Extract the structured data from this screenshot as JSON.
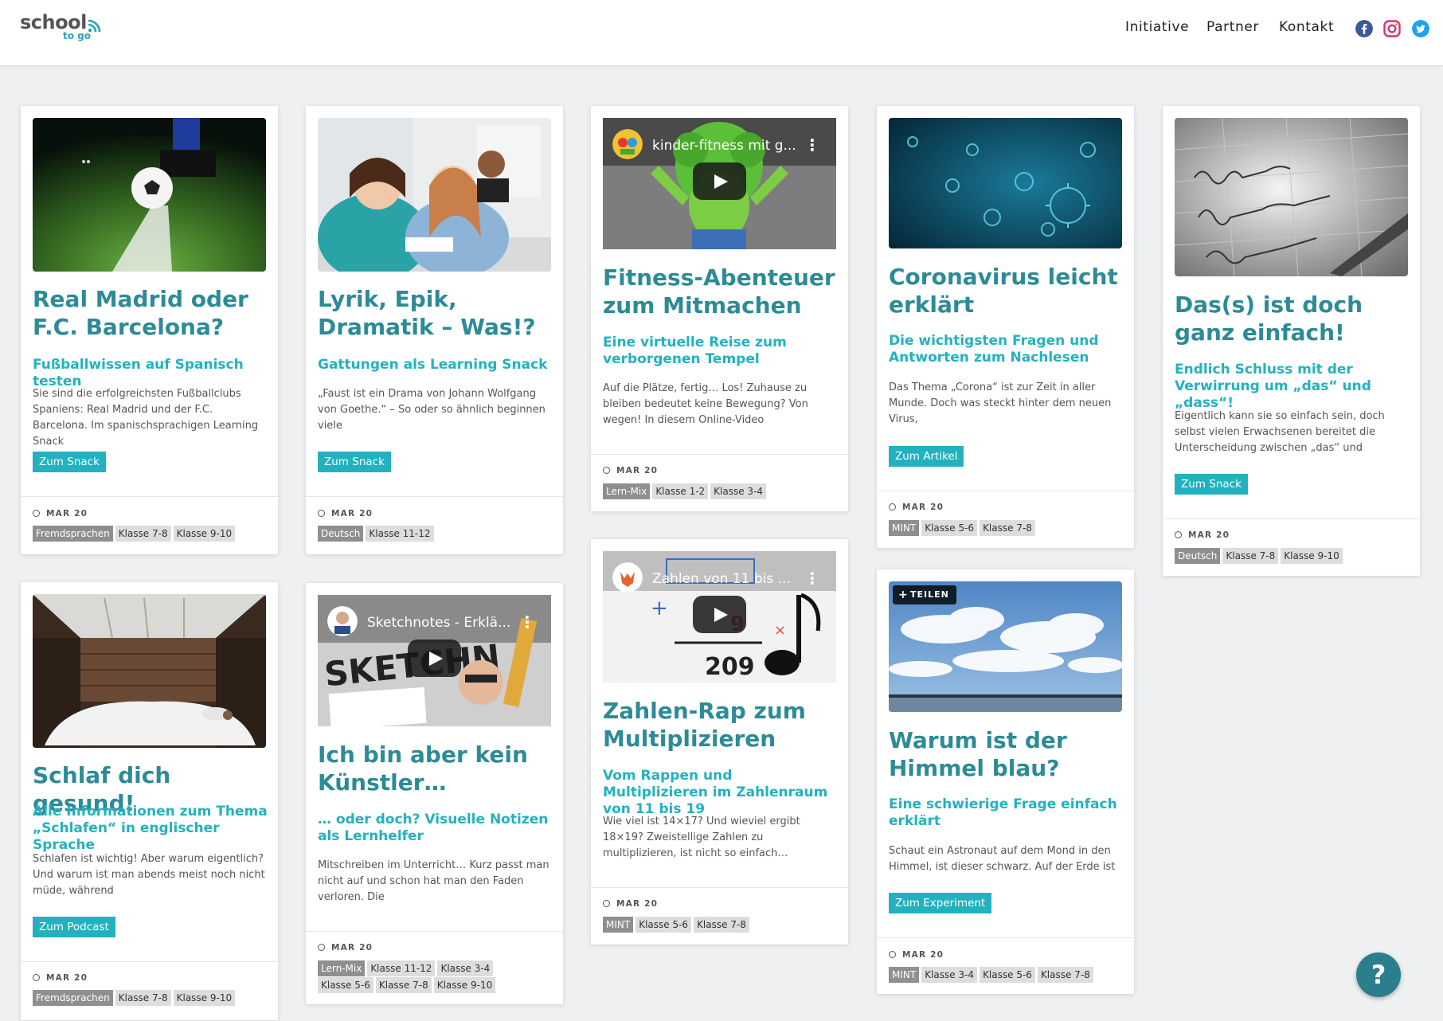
{
  "logo": {
    "line1": "school",
    "line2": "to go"
  },
  "nav": [
    "Initiative",
    "Partner",
    "Kontakt"
  ],
  "social": [
    {
      "name": "facebook-icon",
      "color": "#3b5998"
    },
    {
      "name": "instagram-icon",
      "color": "#e1306c"
    },
    {
      "name": "twitter-icon",
      "color": "#1da1f2"
    }
  ],
  "cards": [
    {
      "title": "Real Madrid oder F.C. Barcelona?",
      "subtitle": "Fußballwissen auf Spanisch testen",
      "text": "Sie sind die erfolgreichsten Fußballclubs Spaniens: Real Madrid und der F.C. Barcelona. Im spanischsprachigen Learning Snack",
      "button": "Zum Snack",
      "date": "MAR 20",
      "tags": [
        "Fremdsprachen",
        "Klasse 7-8",
        "Klasse 9-10"
      ]
    },
    {
      "title": "Lyrik, Epik, Dramatik – Was!?",
      "subtitle": "Gattungen als Learning Snack",
      "text": "„Faust ist ein Drama von Johann Wolfgang von Goethe.“ – So oder so ähnlich beginnen viele",
      "button": "Zum Snack",
      "date": "MAR 20",
      "tags": [
        "Deutsch",
        "Klasse 11-12"
      ]
    },
    {
      "video_title": "kinder-fitness mit g...",
      "title": "Fitness-Abenteuer zum Mitmachen",
      "subtitle": "Eine virtuelle Reise zum verborgenen Tempel",
      "text": "Auf die Plätze, fertig… Los! Zuhause zu bleiben bedeutet keine Bewegung? Von wegen! In diesem Online-Video",
      "date": "MAR 20",
      "tags": [
        "Lern-Mix",
        "Klasse 1-2",
        "Klasse 3-4"
      ]
    },
    {
      "title": "Coronavirus leicht erklärt",
      "subtitle": "Die wichtigsten Fragen und Antworten zum Nachlesen",
      "text": "Das Thema „Corona“ ist zur Zeit in aller Munde. Doch was steckt hinter dem neuen Virus,",
      "button": "Zum Artikel",
      "date": "MAR 20",
      "tags": [
        "MINT",
        "Klasse 5-6",
        "Klasse 7-8"
      ]
    },
    {
      "title": "Das(s) ist doch ganz einfach!",
      "subtitle": "Endlich Schluss mit der Verwirrung um „das“ und „dass“!",
      "text": "Eigentlich kann sie so einfach sein, doch selbst vielen Erwachsenen bereitet die Unterscheidung zwischen „das“ und",
      "button": "Zum Snack",
      "date": "MAR 20",
      "tags": [
        "Deutsch",
        "Klasse 7-8",
        "Klasse 9-10"
      ]
    },
    {
      "title": "Schlaf dich gesund!",
      "subtitle": "Alle Informationen zum Thema „Schlafen“ in englischer Sprache",
      "text": "Schlafen ist wichtig! Aber warum eigentlich? Und warum ist man abends meist noch nicht müde, während",
      "button": "Zum Podcast",
      "date": "MAR 20",
      "tags": [
        "Fremdsprachen",
        "Klasse 7-8",
        "Klasse 9-10"
      ]
    },
    {
      "video_title": "Sketchnotes - Erklä...",
      "title": "Ich bin aber kein Künstler…",
      "subtitle": "… oder doch? Visuelle Notizen als Lernhelfer",
      "text": "Mitschreiben im Unterricht… Kurz passt man nicht auf und schon hat man den Faden verloren. Die",
      "date": "MAR 20",
      "tags": [
        "Lern-Mix",
        "Klasse 11-12",
        "Klasse 3-4",
        "Klasse 5-6",
        "Klasse 7-8",
        "Klasse 9-10"
      ]
    },
    {
      "video_title": "Zahlen von 11 bis ...",
      "title": "Zahlen-Rap zum Multiplizieren",
      "subtitle": "Vom Rappen und Multiplizieren im Zahlenraum von 11 bis 19",
      "text": "Wie viel ist 14×17? Und wieviel ergibt 18×19? Zweistellige Zahlen zu multiplizieren, ist nicht so einfach…",
      "date": "MAR 20",
      "tags": [
        "MINT",
        "Klasse 5-6",
        "Klasse 7-8"
      ]
    },
    {
      "share_label": "TEILEN",
      "title": "Warum ist der Himmel blau?",
      "subtitle": "Eine schwierige Frage einfach erklärt",
      "text": "Schaut ein Astronaut auf dem Mond in den Himmel, ist dieser schwarz. Auf der Erde ist",
      "button": "Zum Experiment",
      "date": "MAR 20",
      "tags": [
        "MINT",
        "Klasse 3-4",
        "Klasse 5-6",
        "Klasse 7-8"
      ]
    }
  ],
  "help": "?"
}
